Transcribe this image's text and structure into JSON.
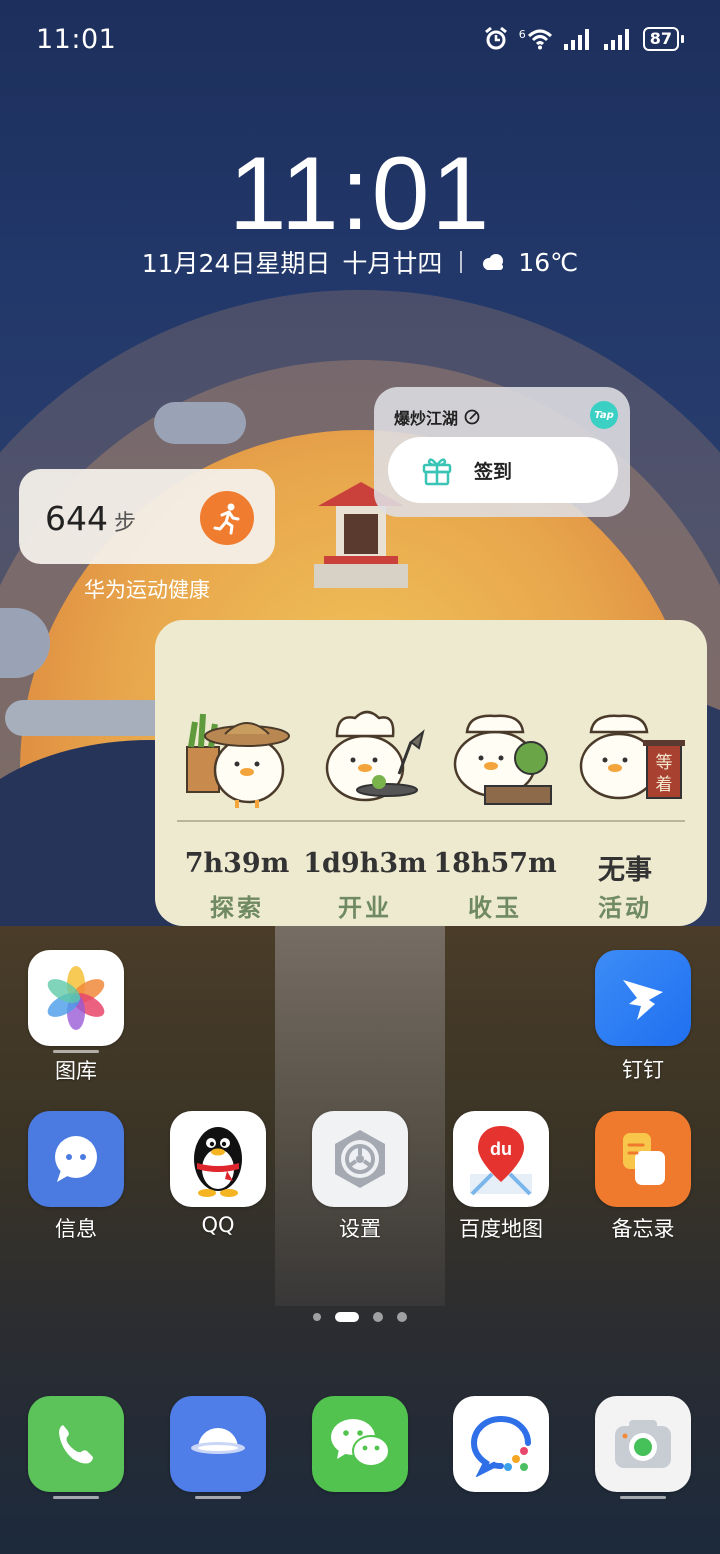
{
  "status_bar": {
    "time": "11:01",
    "network_badge": "6",
    "battery": "87"
  },
  "lock_clock": {
    "time": "11:01",
    "date": "11月24日星期日",
    "lunar": "十月廿四",
    "weather_icon": "cloud-icon",
    "temperature": "16℃"
  },
  "steps_widget": {
    "value": "644",
    "unit": "步",
    "caption": "华为运动健康",
    "icon": "running-icon",
    "accent": "#f07c30"
  },
  "game_widget": {
    "title": "爆炒江湖",
    "badge": "Tap",
    "button_label": "签到",
    "accent": "#3ad1c4"
  },
  "chef_widget": {
    "items": [
      {
        "time": "7h39m",
        "label": "探索",
        "icon": "duck-farmer-icon"
      },
      {
        "time": "1d9h3m",
        "label": "开业",
        "icon": "duck-chef-icon"
      },
      {
        "time": "18h57m",
        "label": "收玉",
        "icon": "duck-cook-icon"
      },
      {
        "time": "无事",
        "label": "活动",
        "icon": "duck-waiting-icon",
        "sign": "等着"
      }
    ]
  },
  "apps": {
    "row1": [
      {
        "label": "图库",
        "icon": "gallery-icon"
      },
      {
        "label": "钉钉",
        "icon": "dingtalk-icon"
      }
    ],
    "row2": [
      {
        "label": "信息",
        "icon": "messages-icon"
      },
      {
        "label": "QQ",
        "icon": "qq-penguin-icon"
      },
      {
        "label": "设置",
        "icon": "settings-icon"
      },
      {
        "label": "百度地图",
        "icon": "baidu-map-icon",
        "text": "du"
      },
      {
        "label": "备忘录",
        "icon": "notes-icon"
      }
    ]
  },
  "page_indicator": {
    "count": 4,
    "active": 2
  },
  "dock": [
    {
      "icon": "phone-icon"
    },
    {
      "icon": "browser-icon"
    },
    {
      "icon": "wechat-icon"
    },
    {
      "icon": "dingtalk-chat-icon"
    },
    {
      "icon": "camera-icon"
    }
  ]
}
